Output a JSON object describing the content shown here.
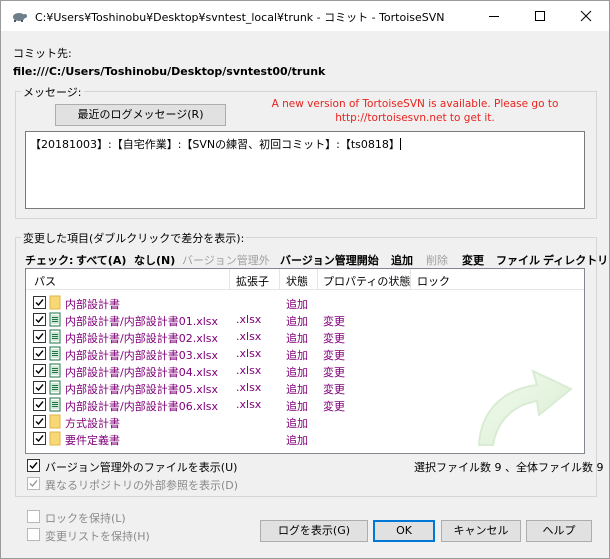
{
  "window": {
    "title": "C:¥Users¥Toshinobu¥Desktop¥svntest_local¥trunk - コミット - TortoiseSVN"
  },
  "commit_to": {
    "label": "コミット先:",
    "url": "file:///C:/Users/Toshinobu/Desktop/svntest00/trunk"
  },
  "message": {
    "group_label": "メッセージ:",
    "recent_button": "最近のログメッセージ(R)",
    "text": "【20181003】:【自宅作業】:【SVNの練習、初回コミット】:【ts0818】",
    "notice_line1": "A new version of TortoiseSVN is available. Please go to",
    "notice_line2": "http://tortoisesvn.net to get it."
  },
  "changes": {
    "group_label": "変更した項目(ダブルクリックで差分を表示):",
    "check_label": "チェック:",
    "filters": [
      {
        "label": "すべて(A)",
        "enabled": true
      },
      {
        "label": "なし(N)",
        "enabled": true
      },
      {
        "label": "バージョン管理外",
        "enabled": false
      },
      {
        "label": "バージョン管理開始",
        "enabled": true
      },
      {
        "label": "追加",
        "enabled": true
      },
      {
        "label": "削除",
        "enabled": false
      },
      {
        "label": "変更",
        "enabled": true
      },
      {
        "label": "ファイル",
        "enabled": true
      },
      {
        "label": "ディレクトリ",
        "enabled": true
      }
    ],
    "columns": [
      "パス",
      "拡張子",
      "状態",
      "プロパティの状態",
      "ロック"
    ],
    "rows": [
      {
        "path": "内部設計書",
        "ext": "",
        "status": "追加",
        "prop_status": "",
        "type": "folder",
        "checked": true
      },
      {
        "path": "内部設計書/内部設計書01.xlsx",
        "ext": ".xlsx",
        "status": "追加",
        "prop_status": "変更",
        "type": "excel",
        "checked": true
      },
      {
        "path": "内部設計書/内部設計書02.xlsx",
        "ext": ".xlsx",
        "status": "追加",
        "prop_status": "変更",
        "type": "excel",
        "checked": true
      },
      {
        "path": "内部設計書/内部設計書03.xlsx",
        "ext": ".xlsx",
        "status": "追加",
        "prop_status": "変更",
        "type": "excel",
        "checked": true
      },
      {
        "path": "内部設計書/内部設計書04.xlsx",
        "ext": ".xlsx",
        "status": "追加",
        "prop_status": "変更",
        "type": "excel",
        "checked": true
      },
      {
        "path": "内部設計書/内部設計書05.xlsx",
        "ext": ".xlsx",
        "status": "追加",
        "prop_status": "変更",
        "type": "excel",
        "checked": true
      },
      {
        "path": "内部設計書/内部設計書06.xlsx",
        "ext": ".xlsx",
        "status": "追加",
        "prop_status": "変更",
        "type": "excel",
        "checked": true
      },
      {
        "path": "方式設計書",
        "ext": "",
        "status": "追加",
        "prop_status": "",
        "type": "folder",
        "checked": true
      },
      {
        "path": "要件定義書",
        "ext": "",
        "status": "追加",
        "prop_status": "",
        "type": "folder",
        "checked": true
      }
    ],
    "show_unversioned": "バージョン管理外のファイルを表示(U)",
    "show_externals": "異なるリポジトリの外部参照を表示(D)",
    "count_text": "選択ファイル数 9 、全体ファイル数 9"
  },
  "bottom": {
    "keep_locks": "ロックを保持(L)",
    "keep_changelists": "変更リストを保持(H)",
    "show_log_button": "ログを表示(G)",
    "ok_button": "OK",
    "cancel_button": "キャンセル",
    "help_button": "ヘルプ"
  },
  "colors": {
    "item_text": "#80007a",
    "notice": "#e8231f",
    "default_button_border": "#0078d7"
  }
}
